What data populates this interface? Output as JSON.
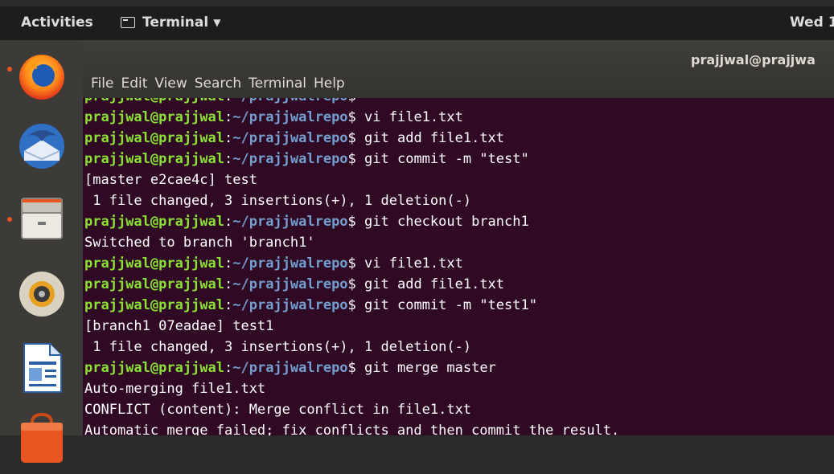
{
  "top_panel": {
    "activities": "Activities",
    "app_menu": "Terminal",
    "clock": "Wed 1"
  },
  "launcher": {
    "items": [
      {
        "name": "Firefox Web Browser",
        "icon": "firefox-icon"
      },
      {
        "name": "Thunderbird Mail",
        "icon": "thunderbird-icon"
      },
      {
        "name": "Files",
        "icon": "files-icon"
      },
      {
        "name": "Rhythmbox",
        "icon": "rhythmbox-icon"
      },
      {
        "name": "LibreOffice Writer",
        "icon": "writer-icon"
      },
      {
        "name": "Ubuntu Software",
        "icon": "software-icon"
      }
    ]
  },
  "window": {
    "title": "prajjwal@prajjwa",
    "menu": [
      "File",
      "Edit",
      "View",
      "Search",
      "Terminal",
      "Help"
    ]
  },
  "terminal": {
    "prompt_user": "prajjwal@prajjwal",
    "prompt_path": "~/prajjwalrepo",
    "lines": [
      {
        "type": "prompt",
        "cmd": ""
      },
      {
        "type": "prompt",
        "cmd": " vi file1.txt"
      },
      {
        "type": "prompt",
        "cmd": " git add file1.txt"
      },
      {
        "type": "prompt",
        "cmd": " git commit -m \"test\""
      },
      {
        "type": "out",
        "text": "[master e2cae4c] test"
      },
      {
        "type": "out",
        "text": " 1 file changed, 3 insertions(+), 1 deletion(-)"
      },
      {
        "type": "prompt",
        "cmd": " git checkout branch1"
      },
      {
        "type": "out",
        "text": "Switched to branch 'branch1'"
      },
      {
        "type": "prompt",
        "cmd": " vi file1.txt"
      },
      {
        "type": "prompt",
        "cmd": " git add file1.txt"
      },
      {
        "type": "prompt",
        "cmd": " git commit -m \"test1\""
      },
      {
        "type": "out",
        "text": "[branch1 07eadae] test1"
      },
      {
        "type": "out",
        "text": " 1 file changed, 3 insertions(+), 1 deletion(-)"
      },
      {
        "type": "prompt",
        "cmd": " git merge master"
      },
      {
        "type": "out",
        "text": "Auto-merging file1.txt"
      },
      {
        "type": "out",
        "text": "CONFLICT (content): Merge conflict in file1.txt"
      },
      {
        "type": "out",
        "text": "Automatic merge failed; fix conflicts and then commit the result."
      }
    ]
  }
}
